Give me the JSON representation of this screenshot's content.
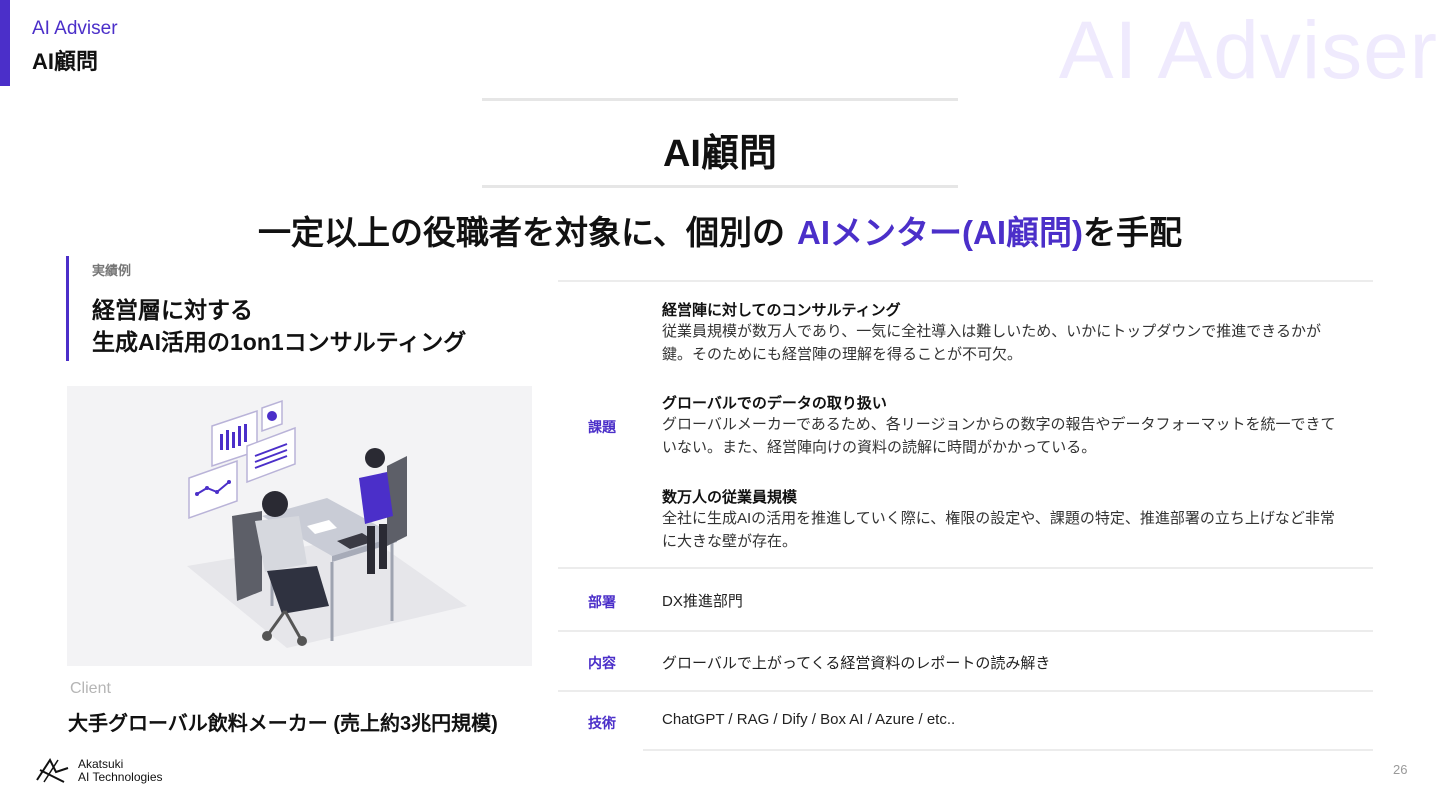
{
  "header": {
    "section_en": "AI Adviser",
    "section_jp": "AI顧問",
    "watermark": "AI Adviser"
  },
  "page": {
    "title": "AI顧問",
    "subtitle_main": "一定以上の役職者を対象に、個別の",
    "subtitle_highlight": "AIメンター(AI顧問)",
    "subtitle_tail": "を手配"
  },
  "case": {
    "label": "実績例",
    "title_line1": "経営層に対する",
    "title_line2": "生成AI活用の1on1コンサルティング",
    "client_label": "Client",
    "client_name": "大手グローバル飲料メーカー (売上約3兆円規模)"
  },
  "details": {
    "issues_label": "課題",
    "issues": [
      {
        "heading": "経営陣に対してのコンサルティング",
        "body": "従業員規模が数万人であり、一気に全社導入は難しいため、いかにトップダウンで推進できるかが鍵。そのためにも経営陣の理解を得ることが不可欠。"
      },
      {
        "heading": "グローバルでのデータの取り扱い",
        "body": "グローバルメーカーであるため、各リージョンからの数字の報告やデータフォーマットを統一できていない。また、経営陣向けの資料の読解に時間がかかっている。"
      },
      {
        "heading": "数万人の従業員規模",
        "body": "全社に生成AIの活用を推進していく際に、権限の設定や、課題の特定、推進部署の立ち上げなど非常に大きな壁が存在。"
      }
    ],
    "department_label": "部署",
    "department_value": "DX推進部門",
    "content_label": "内容",
    "content_value": "グローバルで上がってくる経営資料のレポートの読み解き",
    "tech_label": "技術",
    "tech_value": "ChatGPT / RAG / Dify / Box AI / Azure / etc.."
  },
  "footer": {
    "logo_line1": "Akatsuki",
    "logo_line2": "AI Technologies",
    "page_number": "26"
  },
  "colors": {
    "accent": "#4b2fc9",
    "watermark": "#efeafd",
    "rule": "#ececec"
  }
}
